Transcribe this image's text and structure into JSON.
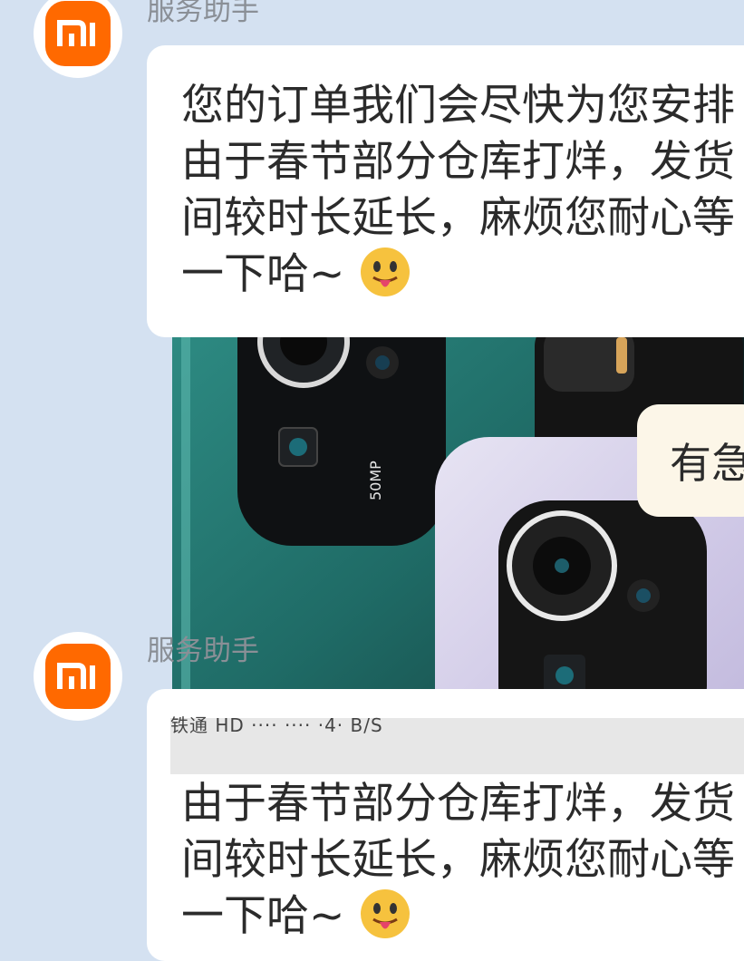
{
  "colors": {
    "background": "#d4e1f1",
    "brand_orange": "#ff6900",
    "bubble": "#ffffff",
    "user_bubble": "#fcf6e8",
    "sender_text": "#8a8f96"
  },
  "messages": [
    {
      "sender": "服务助手",
      "avatar_icon": "xiaomi-logo-icon",
      "lines": [
        "您的订单我们会尽快为您安排",
        "由于春节部分仓库打烊，发货",
        "间较时长延长，麻烦您耐心等",
        "一下哈~"
      ],
      "emoji": "tongue-out-emoji-icon"
    },
    {
      "type": "image",
      "alt_icon": "phone-product-image"
    },
    {
      "sender": "me",
      "text": "有急"
    },
    {
      "sender": "服务助手",
      "avatar_icon": "xiaomi-logo-icon",
      "status_strip": "铁通 HD  ····  ····  ·4·  B/S",
      "lines": [
        "由于春节部分仓库打烊，发货",
        "间较时长延长，麻烦您耐心等",
        "一下哈~"
      ],
      "emoji": "tongue-out-emoji-icon"
    }
  ]
}
